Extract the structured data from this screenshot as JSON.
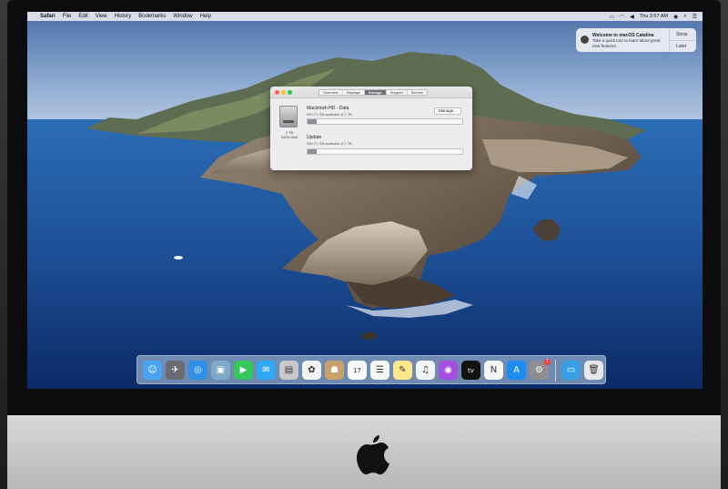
{
  "menubar": {
    "app_name": "Safari",
    "items": [
      "File",
      "Edit",
      "View",
      "History",
      "Bookmarks",
      "Window",
      "Help"
    ],
    "clock": "Thu 3:57 AM"
  },
  "notification": {
    "title": "Welcome to macOS Catalina",
    "body": "Take a quick tour to learn about great new features.",
    "show_label": "Show",
    "later_label": "Later"
  },
  "about_window": {
    "tabs": [
      "Overview",
      "Displays",
      "Storage",
      "Support",
      "Service"
    ],
    "active_tab": "Storage",
    "disk_capacity": "1 TB",
    "disk_type": "SATA Disk",
    "volume_name": "Macintosh HD - Data",
    "volume_available": "940.71 GB available of 1 TB",
    "volume_used_fraction": 0.06,
    "manage_label": "Manage...",
    "update_name": "Update",
    "update_available": "940.71 GB available of 1 TB",
    "update_used_fraction": 0.06
  },
  "dock": {
    "items": [
      {
        "name": "Finder",
        "icon": "finder-icon",
        "color": "#4aa3f0",
        "glyph": "☺"
      },
      {
        "name": "Launchpad",
        "icon": "launchpad-icon",
        "color": "#6b6b74",
        "glyph": "✈"
      },
      {
        "name": "Safari",
        "icon": "safari-icon",
        "color": "#2f8fe8",
        "glyph": "◎"
      },
      {
        "name": "Preview",
        "icon": "preview-icon",
        "color": "#7ea8c8",
        "glyph": "▣"
      },
      {
        "name": "FaceTime",
        "icon": "facetime-icon",
        "color": "#34c759",
        "glyph": "▶"
      },
      {
        "name": "Messages",
        "icon": "messages-icon",
        "color": "#30a8f5",
        "glyph": "✉"
      },
      {
        "name": "Image Capture",
        "icon": "image-capture-icon",
        "color": "#c8c8cc",
        "glyph": "▤"
      },
      {
        "name": "Photos",
        "icon": "photos-icon",
        "color": "#f2f2f2",
        "glyph": "✿"
      },
      {
        "name": "Contacts",
        "icon": "contacts-icon",
        "color": "#c9a26b",
        "glyph": "☗"
      },
      {
        "name": "Calendar",
        "icon": "calendar-icon",
        "color": "#fafafa",
        "glyph": "17"
      },
      {
        "name": "Reminders",
        "icon": "reminders-icon",
        "color": "#f7f7f7",
        "glyph": "☰"
      },
      {
        "name": "Notes",
        "icon": "notes-icon",
        "color": "#fbe78a",
        "glyph": "✎"
      },
      {
        "name": "Music",
        "icon": "music-icon",
        "color": "#f5f5f7",
        "glyph": "♫"
      },
      {
        "name": "Podcasts",
        "icon": "podcasts-icon",
        "color": "#a64ee0",
        "glyph": "◉"
      },
      {
        "name": "TV",
        "icon": "tv-icon",
        "color": "#111111",
        "glyph": "tv"
      },
      {
        "name": "News",
        "icon": "news-icon",
        "color": "#f5f5f7",
        "glyph": "N"
      },
      {
        "name": "App Store",
        "icon": "app-store-icon",
        "color": "#1d8cf3",
        "glyph": "A"
      },
      {
        "name": "System Preferences",
        "icon": "system-preferences-icon",
        "color": "#8e8e93",
        "glyph": "⚙",
        "badge": "1"
      },
      {
        "name": "Downloads",
        "icon": "downloads-folder-icon",
        "color": "#3aa0e6",
        "glyph": "▭"
      },
      {
        "name": "Trash",
        "icon": "trash-icon",
        "color": "#e6e8ea",
        "glyph": "🗑"
      }
    ]
  }
}
